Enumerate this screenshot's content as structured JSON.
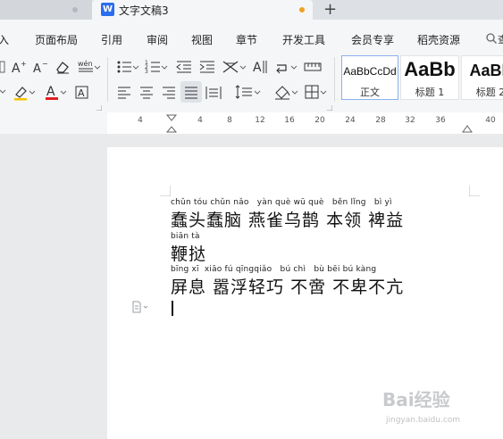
{
  "tabs": {
    "active_title": "文字文稿3",
    "new_tab": "+"
  },
  "menu": {
    "items": [
      "插入",
      "页面布局",
      "引用",
      "审阅",
      "视图",
      "章节",
      "开发工具",
      "会员专享",
      "稻壳资源"
    ],
    "search_chip": "查"
  },
  "toolbar": {
    "font_color_letter": "A",
    "styles": [
      {
        "sample": "AaBbCcDd",
        "label": "正文"
      },
      {
        "sample": "AaBb",
        "label": "标题 1"
      },
      {
        "sample": "AaBb",
        "label": "标题 2"
      }
    ]
  },
  "ruler": {
    "numbers": [
      "4",
      "4",
      "8",
      "12",
      "16",
      "20",
      "24",
      "28",
      "32",
      "36",
      "40"
    ]
  },
  "document": {
    "lines": [
      {
        "pinyin": "chǔn tóu chǔn nǎo   yàn què wū què   běn lǐng   bì yì",
        "hanzi": "蠢头蠢脑 燕雀乌鹊 本领 裨益"
      },
      {
        "pinyin": "biān tà",
        "hanzi": "鞭挞"
      },
      {
        "pinyin": "bīng xī  xiāo fú qīngqiǎo   bú chì   bù bēi bú kàng",
        "hanzi": "屏息 嚣浮轻巧 不啻 不卑不亢"
      }
    ]
  },
  "watermark": {
    "brand": "Bai经验",
    "url": "jingyan.baidu.com"
  },
  "colors": {
    "accent": "#2b6df0",
    "modified": "#f0a020",
    "font_color_underline": "#e02020",
    "highlight_underline": "#f5c400"
  }
}
